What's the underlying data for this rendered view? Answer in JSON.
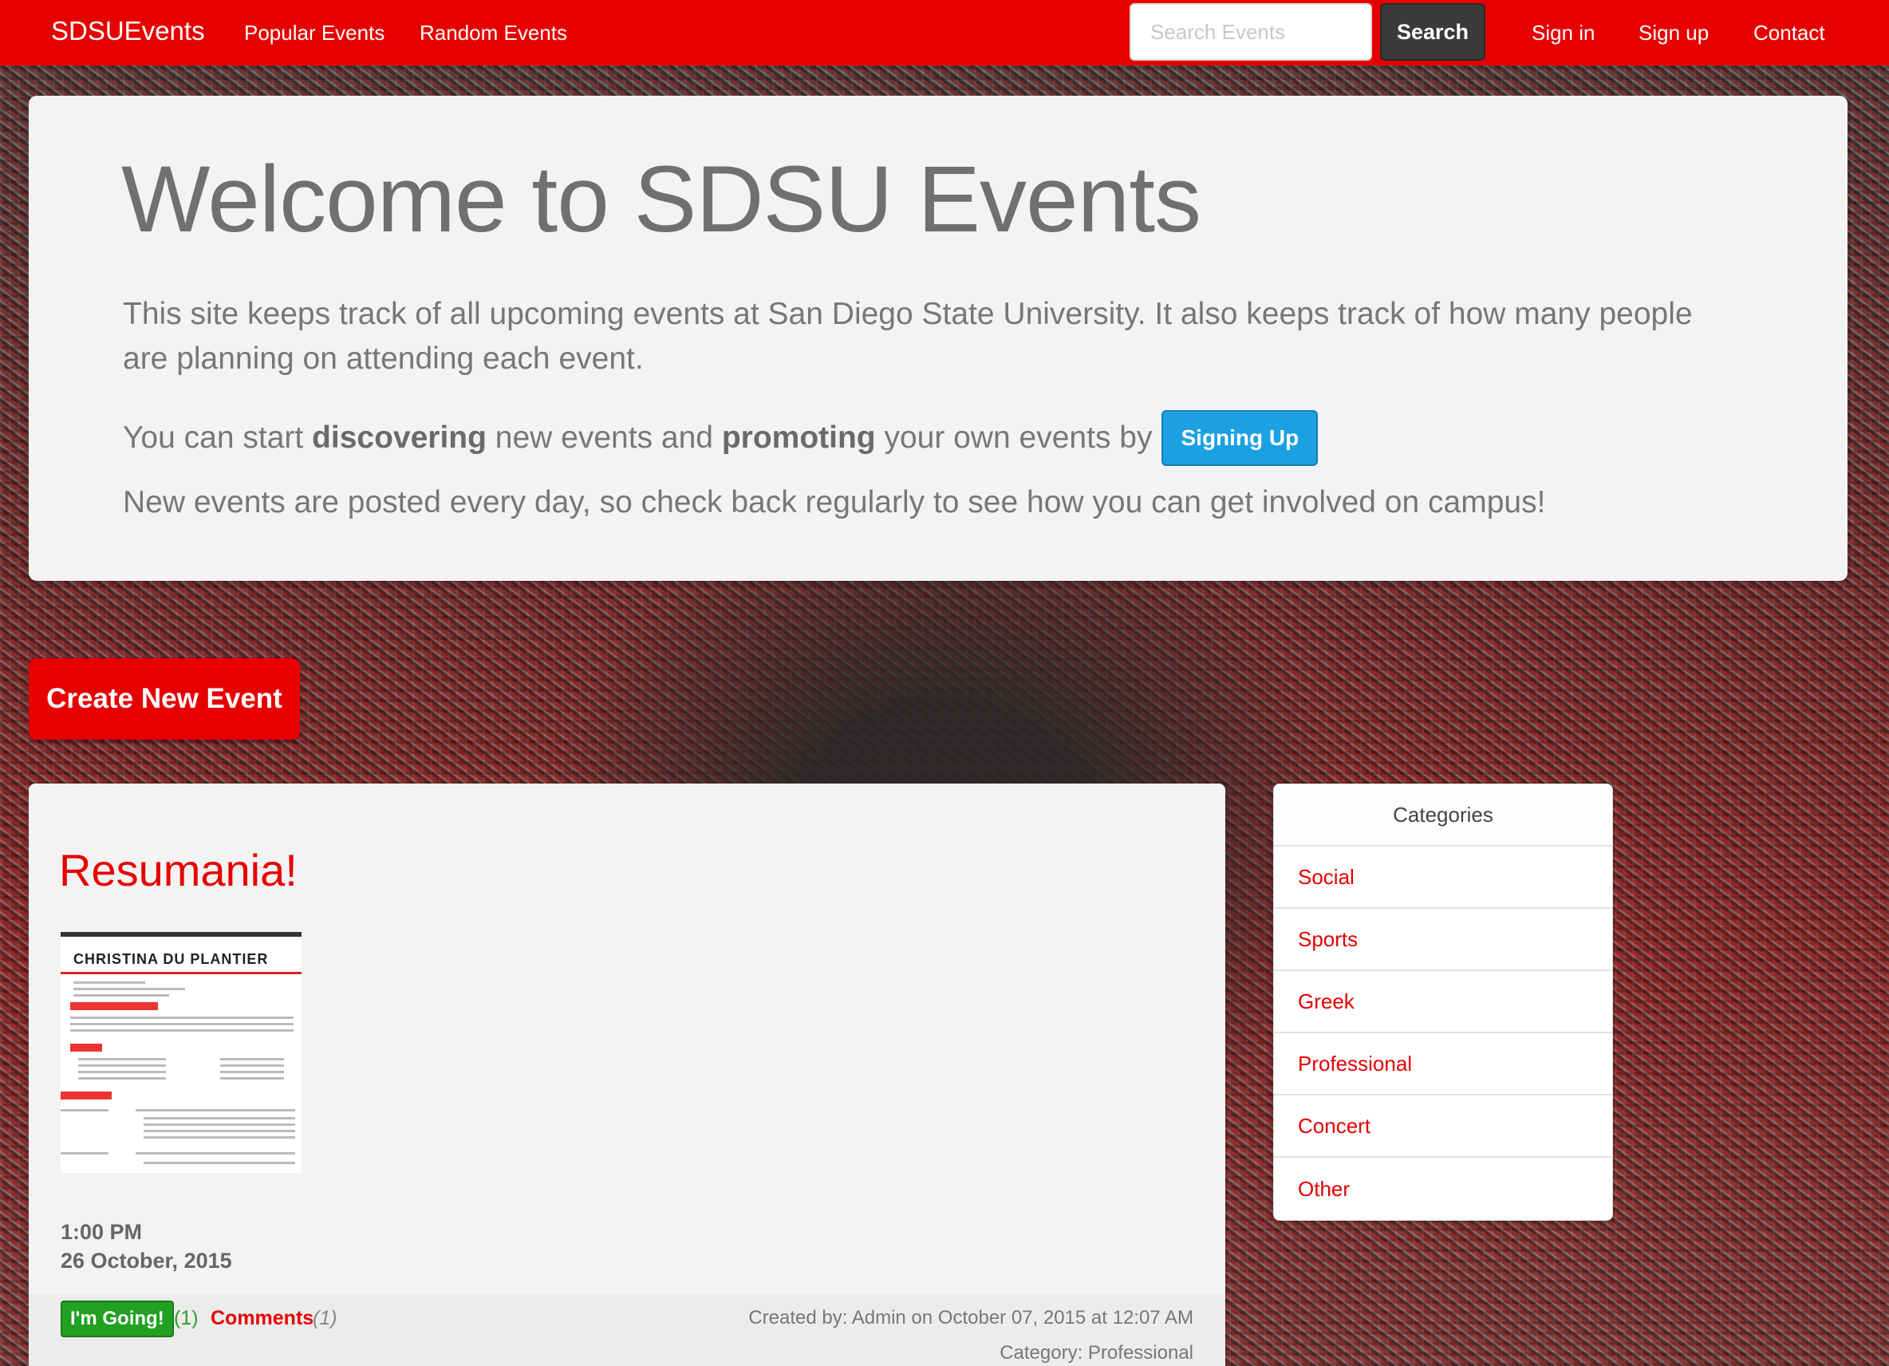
{
  "navbar": {
    "brand": "SDSUEvents",
    "links": [
      "Popular Events",
      "Random Events"
    ],
    "search_placeholder": "Search Events",
    "search_button": "Search",
    "right_links": [
      "Sign in",
      "Sign up",
      "Contact"
    ]
  },
  "jumbotron": {
    "title": "Welcome to SDSU Events",
    "intro": "This site keeps track of all upcoming events at San Diego State University. It also keeps track of how many people are planning on attending each event.",
    "cta_prefix": "You can start ",
    "cta_bold1": "discovering",
    "cta_mid": " new events and ",
    "cta_bold2": "promoting",
    "cta_suffix": " your own events by",
    "signup_button": "Signing Up",
    "footer_text": "New events are posted every day, so check back regularly to see how you can get involved on campus!"
  },
  "create_button": "Create New Event",
  "event": {
    "title": "Resumania!",
    "thumbnail_name": "CHRISTINA DU PLANTIER",
    "time": "1:00 PM",
    "date": "26 October, 2015",
    "going_button": "I'm Going!",
    "going_count": "(1)",
    "comments_label": "Comments",
    "comments_count": "(1)",
    "created_by": "Created by: Admin on October 07, 2015 at 12:07 AM",
    "category": "Category: Professional"
  },
  "categories": {
    "heading": "Categories",
    "items": [
      "Social",
      "Sports",
      "Greek",
      "Professional",
      "Concert",
      "Other"
    ]
  },
  "colors": {
    "brand_red": "#e60000",
    "signup_blue": "#1ba1e2",
    "going_green": "#22a022"
  }
}
